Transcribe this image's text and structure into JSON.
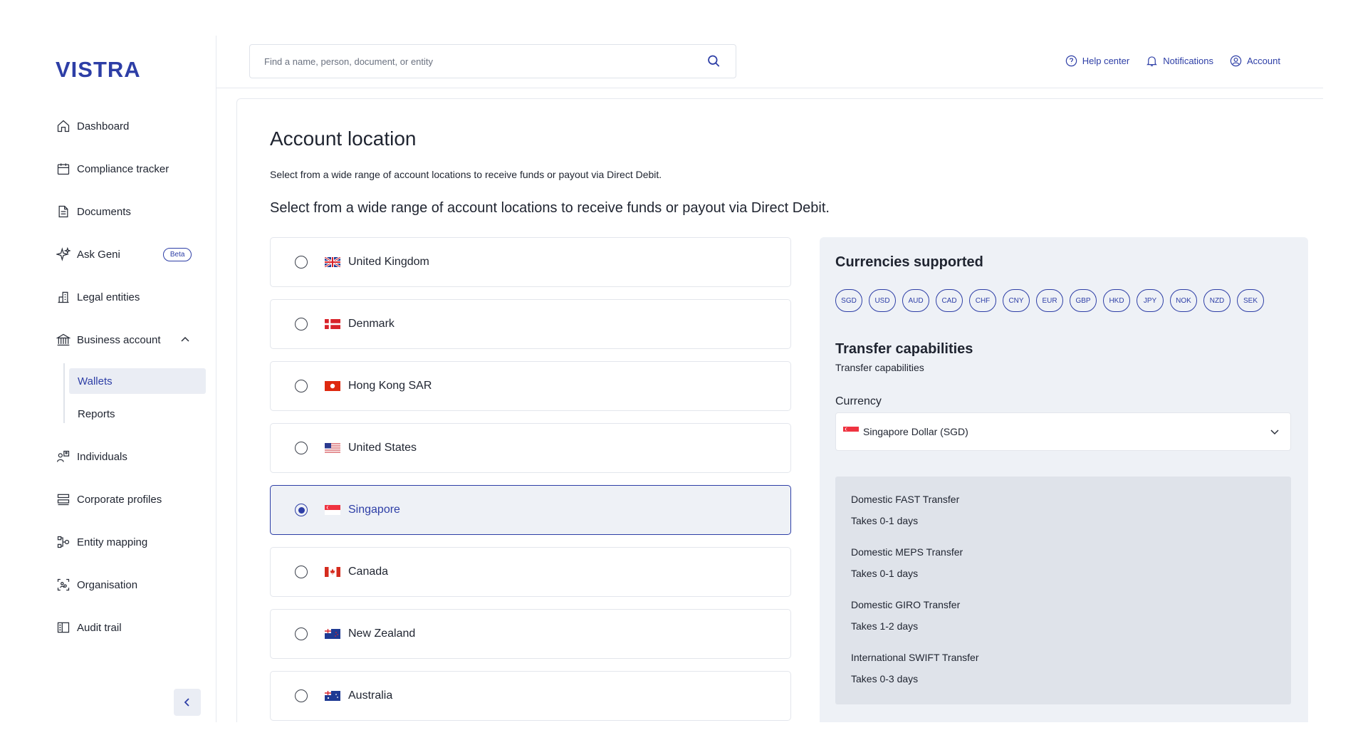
{
  "brand": {
    "name": "VISTRA",
    "color": "#2d3ea6"
  },
  "sidebar": {
    "items": [
      {
        "label": "Dashboard",
        "icon": "home-icon"
      },
      {
        "label": "Compliance tracker",
        "icon": "calendar-icon"
      },
      {
        "label": "Documents",
        "icon": "document-icon"
      },
      {
        "label": "Ask Geni",
        "icon": "sparkle-icon",
        "badge": "Beta"
      },
      {
        "label": "Legal entities",
        "icon": "building-icon"
      },
      {
        "label": "Business account",
        "icon": "bank-icon",
        "expanded": true
      },
      {
        "label": "Individuals",
        "icon": "people-icon"
      },
      {
        "label": "Corporate profiles",
        "icon": "stack-icon"
      },
      {
        "label": "Entity mapping",
        "icon": "hierarchy-icon"
      },
      {
        "label": "Organisation",
        "icon": "organisation-icon"
      },
      {
        "label": "Audit trail",
        "icon": "book-icon"
      }
    ],
    "sub_items": [
      {
        "label": "Wallets",
        "active": true
      },
      {
        "label": "Reports",
        "active": false
      }
    ]
  },
  "header": {
    "search_placeholder": "Find a name, person, document, or entity",
    "links": [
      {
        "label": "Help center",
        "icon": "help-circle-icon"
      },
      {
        "label": "Notifications",
        "icon": "bell-icon"
      },
      {
        "label": "Account",
        "icon": "user-circle-icon"
      }
    ]
  },
  "main": {
    "title": "Account location",
    "desc_small": "Select from a wide range of account locations to receive funds or payout via Direct Debit.",
    "desc_large": "Select from a wide range of account locations to receive funds or payout via Direct Debit.",
    "locations": [
      {
        "label": "United Kingdom",
        "flag": "uk",
        "selected": false
      },
      {
        "label": "Denmark",
        "flag": "dk",
        "selected": false
      },
      {
        "label": "Hong Kong SAR",
        "flag": "hk",
        "selected": false
      },
      {
        "label": "United States",
        "flag": "us",
        "selected": false
      },
      {
        "label": "Singapore",
        "flag": "sg",
        "selected": true
      },
      {
        "label": "Canada",
        "flag": "ca",
        "selected": false
      },
      {
        "label": "New Zealand",
        "flag": "nz",
        "selected": false
      },
      {
        "label": "Australia",
        "flag": "au",
        "selected": false
      }
    ]
  },
  "panel": {
    "currencies_title": "Currencies supported",
    "currencies": [
      "SGD",
      "USD",
      "AUD",
      "CAD",
      "CHF",
      "CNY",
      "EUR",
      "GBP",
      "HKD",
      "JPY",
      "NOK",
      "NZD",
      "SEK"
    ],
    "transfer_title": "Transfer capabilities",
    "transfer_subtitle": "Transfer capabilities",
    "currency_label": "Currency",
    "currency_value": "Singapore Dollar (SGD)",
    "transfers": [
      {
        "name": "Domestic FAST Transfer",
        "time": "Takes 0-1 days"
      },
      {
        "name": "Domestic MEPS Transfer",
        "time": "Takes 0-1 days"
      },
      {
        "name": "Domestic GIRO Transfer",
        "time": "Takes 1-2 days"
      },
      {
        "name": "International SWIFT Transfer",
        "time": "Takes 0-3 days"
      }
    ]
  }
}
